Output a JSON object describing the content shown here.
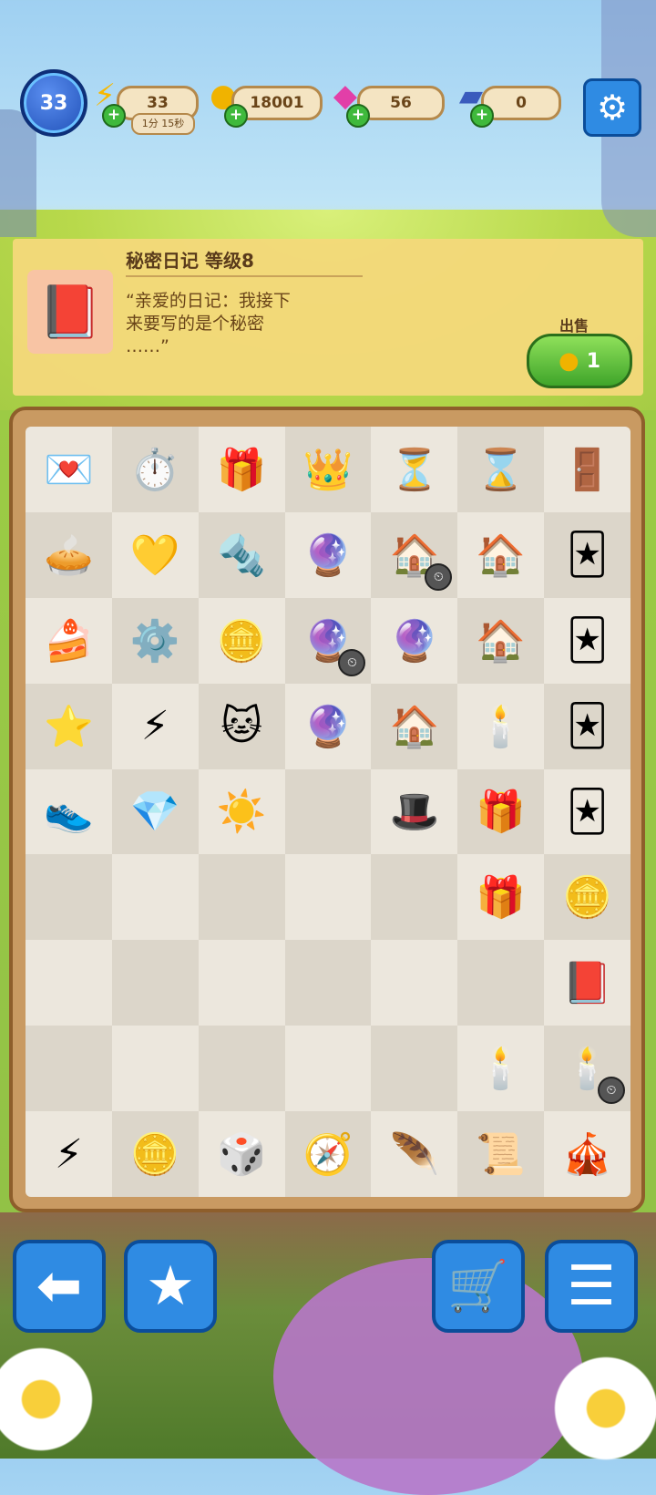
{
  "hud": {
    "level": "33",
    "energy": "33",
    "energy_timer": "1分 15秒",
    "coins": "18001",
    "gems": "56",
    "cards": "0",
    "plus": "+",
    "settings_icon": "gear-icon"
  },
  "info_panel": {
    "title": "秘密日记 等级8",
    "description": "“亲爱的日记：我接下\n来要写的是个秘密\n……”",
    "sell_label": "出售",
    "sell_price": "1"
  },
  "board": {
    "rows": [
      [
        "💌",
        "⏱️",
        "🎁",
        "👑",
        "⏳",
        "⌛",
        "🚪"
      ],
      [
        "🥧",
        "💛",
        "🔩",
        "🔮",
        "🏠",
        "🏠",
        "🃏"
      ],
      [
        "🍰",
        "⚙️",
        "🪙",
        "🔮",
        "🔮",
        "🏠",
        "🃏"
      ],
      [
        "⭐",
        "⚡",
        "🐱",
        "🔮",
        "🏠",
        "🕯️",
        "🃏"
      ],
      [
        "👟",
        "💎",
        "☀️",
        "",
        "🎩",
        "🎁",
        "🃏"
      ],
      [
        "",
        "",
        "",
        "",
        "",
        "🎁",
        "🪙"
      ],
      [
        "",
        "",
        "",
        "",
        "",
        "",
        "📕"
      ],
      [
        "",
        "",
        "",
        "",
        "",
        "🕯️",
        "🕯️"
      ],
      [
        "⚡",
        "🪙",
        "🎲",
        "🧭",
        "🪶",
        "📜",
        "🎪"
      ]
    ],
    "locked_cells": [
      [
        1,
        4
      ],
      [
        2,
        3
      ],
      [
        7,
        6
      ]
    ]
  },
  "buttons": {
    "back": "⬅",
    "star": "★",
    "cart": "🛒",
    "tasks": "☰"
  }
}
